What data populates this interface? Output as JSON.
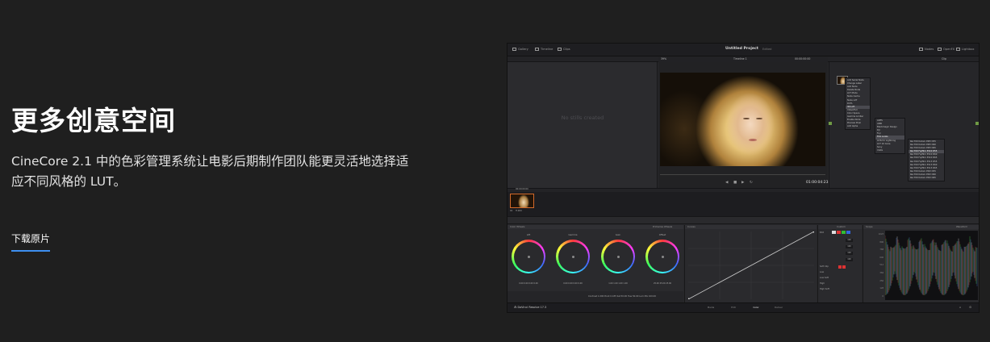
{
  "hero": {
    "title": "更多创意空间",
    "description": "CineCore 2.1 中的色彩管理系统让电影后期制作团队能更灵活地选择适应不同风格的 LUT。",
    "download_label": "下载原片"
  },
  "app": {
    "topbar": {
      "left_items": [
        "Gallery",
        "Timeline",
        "Clips"
      ],
      "project_title": "Untitled Project",
      "project_status": "Edited",
      "right_items": [
        "Nodes",
        "OpenFX",
        "Lightbox"
      ]
    },
    "viewer": {
      "zoom": "39%",
      "timeline_name": "Timeline 1",
      "timecode_top": "00:00:00:00",
      "timecode": "01:00:04:23",
      "mode": "Clip"
    },
    "gallery": {
      "empty_text": "No stills created"
    },
    "context_menu": {
      "items": [
        "Add Serial Node",
        "Change Label",
        "Add Node",
        "Delete Node",
        "LUT Mode",
        "Node Cache",
        "Node LUT",
        "DCTL",
        "3D LUT",
        "Video/Full",
        "Color Space",
        "Gamma Limiter",
        "Enable Node",
        "Preview Pixel",
        "Add Alpha"
      ],
      "highlight": "3D LUT"
    },
    "submenu1": {
      "items": [
        "ACES",
        "ARRI",
        "Blackmagic Design",
        "DJI",
        "Fuji",
        "Film Looks",
        "LUTs for Lightning",
        "LUT 10 Cube",
        "Sony",
        "VLOG"
      ],
      "highlight": "Film Looks"
    },
    "submenu2": {
      "items": [
        "Rec709 Kodak 2383 D55",
        "Rec709 Kodak 2383 D60",
        "Rec709 Kodak 2383 D65",
        "Rec709 Fujifilm 3510 D55",
        "Rec709 Fujifilm 3510 D60",
        "Rec709 Fujifilm 3510 D65",
        "Rec709 Fujifilm 3513 D55",
        "Rec709 Fujifilm 3513 D60",
        "Rec709 Fujifilm 3513 D65",
        "Rec709 Kodak 2393 D55",
        "Rec709 Kodak 2393 D60",
        "Rec709 Kodak 2393 D65"
      ],
      "highlight": "Rec709 Fujifilm 3510 D55"
    },
    "clips": {
      "number": "01",
      "timecode": "00:00:00:00",
      "codec": "H.264"
    },
    "wheels": {
      "header": "Color Wheels",
      "mode": "Primaries Wheels",
      "items": [
        {
          "label": "Lift",
          "values": "0.00  0.00  0.00  0.00"
        },
        {
          "label": "Gamma",
          "values": "0.00  0.00  0.00  0.00"
        },
        {
          "label": "Gain",
          "values": "1.00  1.00  1.00  1.00"
        },
        {
          "label": "Offset",
          "values": "25.00  25.00  25.00"
        }
      ],
      "status": "Contrast 1.000   Pivot 0.435   Sat 50.00   Hue 50.00   Lum Mix 100.00"
    },
    "curves": {
      "header": "Curves"
    },
    "custom": {
      "header": "Custom",
      "values": [
        "100",
        "100",
        "100",
        "100"
      ],
      "labels": [
        "Edit",
        "Soft Clip",
        "Low",
        "Low Soft",
        "High",
        "High Soft"
      ]
    },
    "scope": {
      "header": "Scope",
      "mode": "Waveform",
      "scale": [
        "1023",
        "896",
        "768",
        "640",
        "512",
        "384",
        "256",
        "128",
        "0"
      ]
    },
    "bottom": {
      "brand": "DaVinci Resolve 17.3",
      "pages": [
        "Media",
        "Edit",
        "Color",
        "Deliver"
      ],
      "active_page": "Color"
    }
  }
}
